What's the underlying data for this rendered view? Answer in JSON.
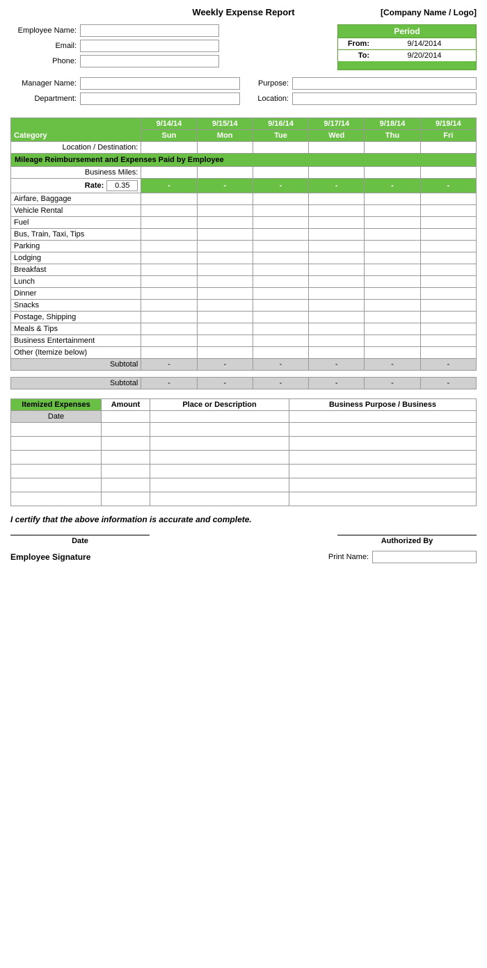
{
  "header": {
    "title": "Weekly Expense Report",
    "company": "[Company Name / Logo]"
  },
  "employee": {
    "name_label": "Employee Name:",
    "email_label": "Email:",
    "phone_label": "Phone:",
    "name_value": "",
    "email_value": "",
    "phone_value": ""
  },
  "period": {
    "label": "Period",
    "from_label": "From:",
    "from_value": "9/14/2014",
    "to_label": "To:",
    "to_value": "9/20/2014"
  },
  "manager": {
    "name_label": "Manager Name:",
    "department_label": "Department:",
    "purpose_label": "Purpose:",
    "location_label": "Location:",
    "name_value": "",
    "department_value": "",
    "purpose_value": "",
    "location_value": ""
  },
  "table": {
    "category_header": "Category",
    "location_label": "Location / Destination:",
    "mileage_section": "Mileage Reimbursement and Expenses Paid by Employee",
    "business_miles_label": "Business Miles:",
    "rate_label": "Rate:",
    "rate_value": "0.35",
    "dates": [
      "9/14/14",
      "9/15/14",
      "9/16/14",
      "9/17/14",
      "9/18/14",
      "9/19/14"
    ],
    "days": [
      "Sun",
      "Mon",
      "Tue",
      "Wed",
      "Thu",
      "Fri"
    ],
    "dash": "-",
    "categories": [
      "Airfare, Baggage",
      "Vehicle Rental",
      "Fuel",
      "Bus, Train, Taxi, Tips",
      "Parking",
      "Lodging",
      "Breakfast",
      "Lunch",
      "Dinner",
      "Snacks",
      "Postage, Shipping",
      "Meals & Tips",
      "Business Entertainment",
      "Other (Itemize below)"
    ],
    "subtotal_label": "Subtotal"
  },
  "itemized": {
    "header_label": "Itemized Expenses",
    "amount_label": "Amount",
    "place_label": "Place or Description",
    "business_label": "Business Purpose / Business",
    "date_label": "Date",
    "rows": 7
  },
  "certification": {
    "text": "I certify that the above information is accurate and complete."
  },
  "signature": {
    "date_label": "Date",
    "authorized_label": "Authorized By",
    "employee_sig_label": "Employee Signature",
    "print_name_label": "Print Name:"
  }
}
